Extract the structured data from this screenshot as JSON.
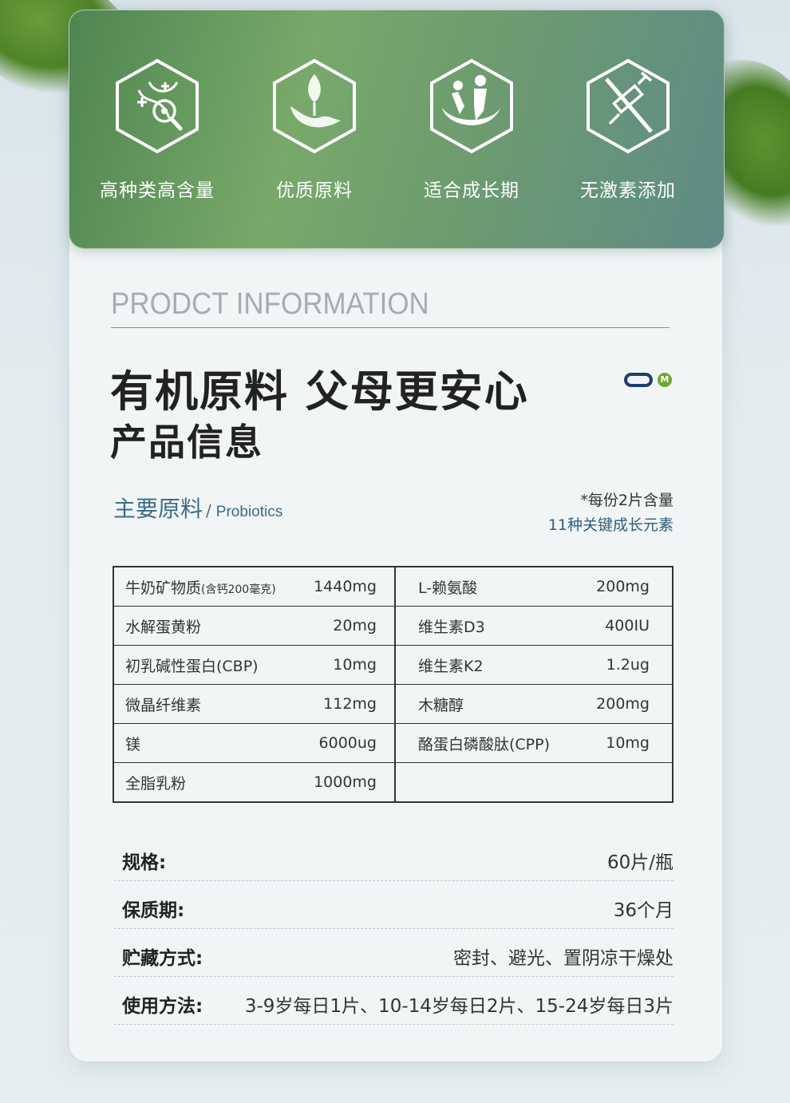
{
  "features": [
    {
      "icon": "dna-magnifier-icon",
      "label": "高种类高含量"
    },
    {
      "icon": "leaf-hand-icon",
      "label": "优质原料"
    },
    {
      "icon": "family-growth-icon",
      "label": "适合成长期"
    },
    {
      "icon": "no-hormone-syringe-icon",
      "label": "无激素添加"
    }
  ],
  "info": {
    "english_title": "PRODCT INFORMATION",
    "headline": "有机原料 父母更安心",
    "subhead": "产品信息",
    "logo_letter": "M"
  },
  "ingredients": {
    "title": "主要原料",
    "separator": "/",
    "title_en": "Probiotics",
    "note_serving": "*每份2片含量",
    "note_count": "11种关键成长元素",
    "rows": [
      {
        "left_name": "牛奶矿物质",
        "left_name_small": "(含钙200毫克)",
        "left_value": "1440mg",
        "right_name": "L-赖氨酸",
        "right_value": "200mg"
      },
      {
        "left_name": "水解蛋黄粉",
        "left_name_small": "",
        "left_value": "20mg",
        "right_name": "维生素D3",
        "right_value": "400IU"
      },
      {
        "left_name": "初乳碱性蛋白(CBP)",
        "left_name_small": "",
        "left_value": "10mg",
        "right_name": "维生素K2",
        "right_value": "1.2ug"
      },
      {
        "left_name": "微晶纤维素",
        "left_name_small": "",
        "left_value": "112mg",
        "right_name": "木糖醇",
        "right_value": "200mg"
      },
      {
        "left_name": "镁",
        "left_name_small": "",
        "left_value": "6000ug",
        "right_name": "酪蛋白磷酸肽(CPP)",
        "right_value": "10mg"
      },
      {
        "left_name": "全脂乳粉",
        "left_name_small": "",
        "left_value": "1000mg",
        "right_name": "",
        "right_value": ""
      }
    ]
  },
  "specs": [
    {
      "key": "规格:",
      "value": "60片/瓶"
    },
    {
      "key": "保质期:",
      "value": "36个月"
    },
    {
      "key": "贮藏方式:",
      "value": "密封、避光、置阴凉干燥处"
    },
    {
      "key": "使用方法:",
      "value": "3-9岁每日1片、10-14岁每日2片、15-24岁每日3片"
    }
  ],
  "colors": {
    "panel_green": "#6d9c6f",
    "accent_blue": "#3b6c86",
    "logo_navy": "#1f3d6e",
    "logo_green": "#6aaa2e"
  }
}
